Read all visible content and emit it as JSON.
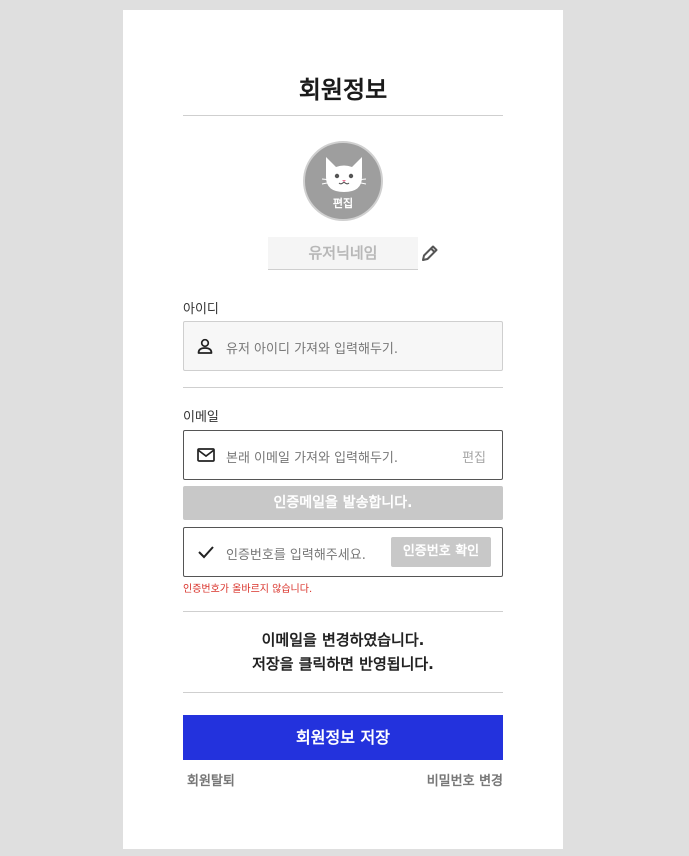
{
  "page": {
    "title": "회원정보"
  },
  "profile": {
    "avatar_icon": "cat-face-icon",
    "avatar_edit_label": "편집",
    "nickname_placeholder": "유저닉네임",
    "nickname_edit_icon": "pencil-icon"
  },
  "id_section": {
    "label": "아이디",
    "icon": "user-icon",
    "value": "유저 아이디 가져와 입력해두기."
  },
  "email_section": {
    "label": "이메일",
    "icon": "mail-icon",
    "value": "본래 이메일 가져와 입력해두기.",
    "edit_label": "편집",
    "send_button": "인증메일을 발송합니다.",
    "code_icon": "check-icon",
    "code_placeholder": "인증번호를 입력해주세요.",
    "verify_button": "인증번호 확인",
    "error_text": "인증번호가 올바르지 않습니다."
  },
  "notice": {
    "line1": "이메일을 변경하였습니다.",
    "line2": "저장을 클릭하면 반영됩니다."
  },
  "actions": {
    "save_button": "회원정보 저장",
    "withdraw_link": "회원탈퇴",
    "change_password_link": "비밀번호 변경"
  },
  "colors": {
    "primary": "#2332dd",
    "disabled_button": "#c8c8c8",
    "error": "#d9322a",
    "background": "#dfdfdf"
  }
}
